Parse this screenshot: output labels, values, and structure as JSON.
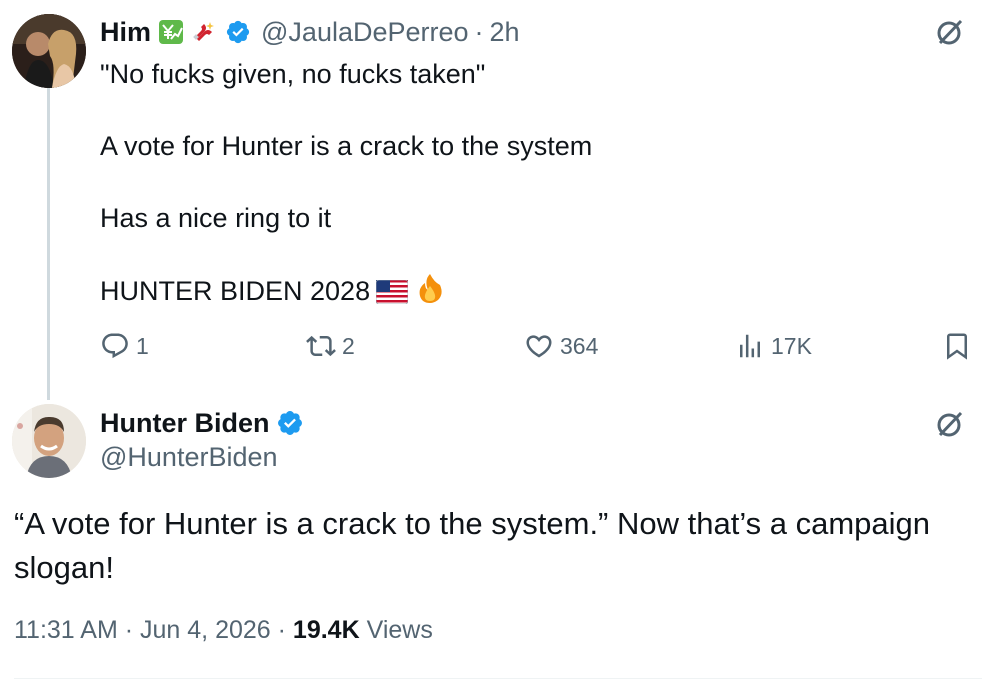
{
  "tweet1": {
    "name": "Him",
    "badges": [
      "chart-yen-emoji",
      "magnet-emoji",
      "verified-badge"
    ],
    "handle": "@JaulaDePerreo",
    "dot": "·",
    "time": "2h",
    "lines": [
      "\"No fucks given, no fucks taken\"",
      "A vote for Hunter is a crack to the system",
      "Has a nice ring to it",
      "HUNTER BIDEN 2028"
    ],
    "trailing_emojis": [
      "us-flag-emoji",
      "fire-emoji"
    ],
    "actions": {
      "replies": "1",
      "retweets": "2",
      "likes": "364",
      "views": "17K"
    }
  },
  "tweet2": {
    "name": "Hunter Biden",
    "handle": "@HunterBiden",
    "text": "“A vote for Hunter is a crack to the system.” Now that’s a campaign slogan!",
    "time": "11:31 AM",
    "dot": "·",
    "date": "Jun 4, 2026",
    "views_count": "19.4K",
    "views_label": "Views"
  },
  "colors": {
    "text": "#0f1419",
    "secondary": "#536471",
    "verified": "#1d9bf0",
    "thread_line": "#cfd9de"
  }
}
